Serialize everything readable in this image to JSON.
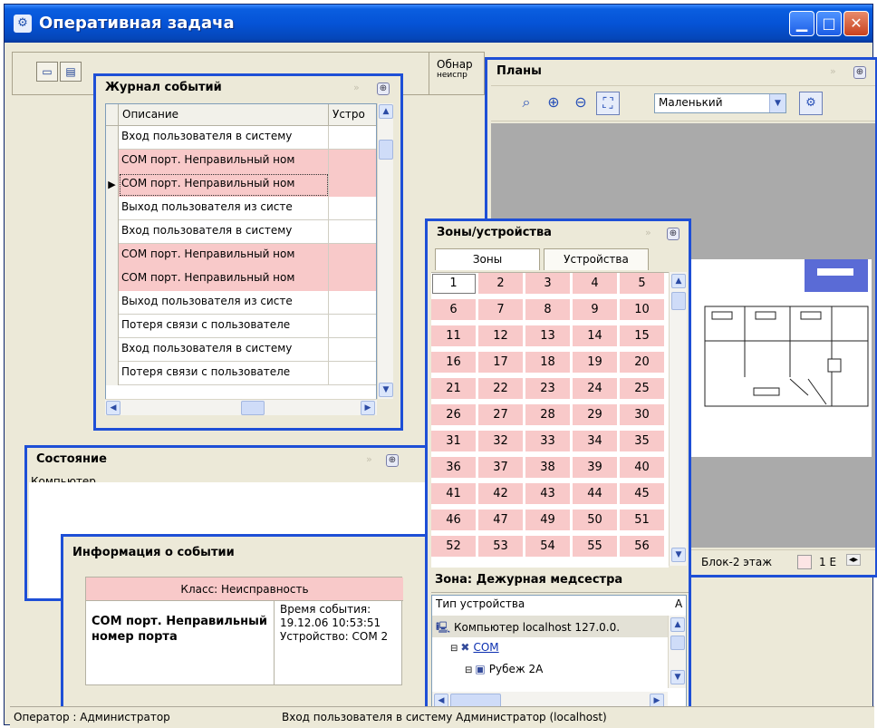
{
  "window": {
    "title": "Оперативная задача",
    "minimize_icon": "minimize-icon",
    "maximize_icon": "maximize-icon",
    "close_icon": "close-icon",
    "minimize_glyph": "▁",
    "maximize_glyph": "□",
    "close_glyph": "✕"
  },
  "toolbar": {
    "obn_label": "Обнар",
    "obn_sub": "неиспр"
  },
  "journal": {
    "title": "Журнал событий",
    "columns": [
      "Описание",
      "Устро"
    ],
    "rows": [
      {
        "desc": "Вход пользователя в систему",
        "error": false
      },
      {
        "desc": "COM порт. Неправильный ном",
        "error": true
      },
      {
        "desc": "COM порт. Неправильный ном",
        "error": true,
        "current": true
      },
      {
        "desc": "Выход пользователя из систе",
        "error": false
      },
      {
        "desc": "Вход пользователя в систему",
        "error": false
      },
      {
        "desc": "COM порт. Неправильный ном",
        "error": true
      },
      {
        "desc": "COM порт. Неправильный ном",
        "error": true
      },
      {
        "desc": "Выход пользователя из систе",
        "error": false
      },
      {
        "desc": "Потеря связи с пользователе",
        "error": false
      },
      {
        "desc": "Вход пользователя в систему",
        "error": false
      },
      {
        "desc": "Потеря связи с пользователе",
        "error": false
      }
    ]
  },
  "plans": {
    "title": "Планы",
    "size_value": "Маленький",
    "status_text": "Блок-2 этаж",
    "status_right": "1 Е"
  },
  "zones": {
    "title": "Зоны/устройства",
    "tabs": [
      "Зоны",
      "Устройства"
    ],
    "numbers": [
      "1",
      "2",
      "3",
      "4",
      "5",
      "6",
      "7",
      "8",
      "9",
      "10",
      "11",
      "12",
      "13",
      "14",
      "15",
      "16",
      "17",
      "18",
      "19",
      "20",
      "21",
      "22",
      "23",
      "24",
      "25",
      "26",
      "27",
      "28",
      "29",
      "30",
      "31",
      "32",
      "33",
      "34",
      "35",
      "36",
      "37",
      "38",
      "39",
      "40",
      "41",
      "42",
      "43",
      "44",
      "45",
      "46",
      "47",
      "49",
      "50",
      "51",
      "52",
      "53",
      "54",
      "55",
      "56"
    ],
    "selected": "1",
    "zone_name": "Зона: Дежурная медсестра",
    "device_header": "Тип устройства",
    "device_header_2": "А",
    "tree": [
      {
        "label": "Компьютер localhost 127.0.0.",
        "level": 0,
        "icon": "computer-icon",
        "selected": true
      },
      {
        "label": "COM",
        "level": 1,
        "icon": "com-port-icon",
        "link": true
      },
      {
        "label": "Рубеж 2А",
        "level": 2,
        "icon": "device-icon"
      }
    ]
  },
  "state": {
    "title": "Состояние",
    "column": "Компьютер"
  },
  "event_info": {
    "title": "Информация о событии",
    "class_text": "Класс: Неисправность",
    "description": "COM порт. Неправильный номер порта",
    "time_label": "Время события:",
    "time_value": "19.12.06 10:53:51",
    "device": "Устройство: COM 2"
  },
  "status_bar": {
    "operator": "Оператор : Администратор",
    "message": "Вход пользователя в систему Администратор (localhost)"
  }
}
